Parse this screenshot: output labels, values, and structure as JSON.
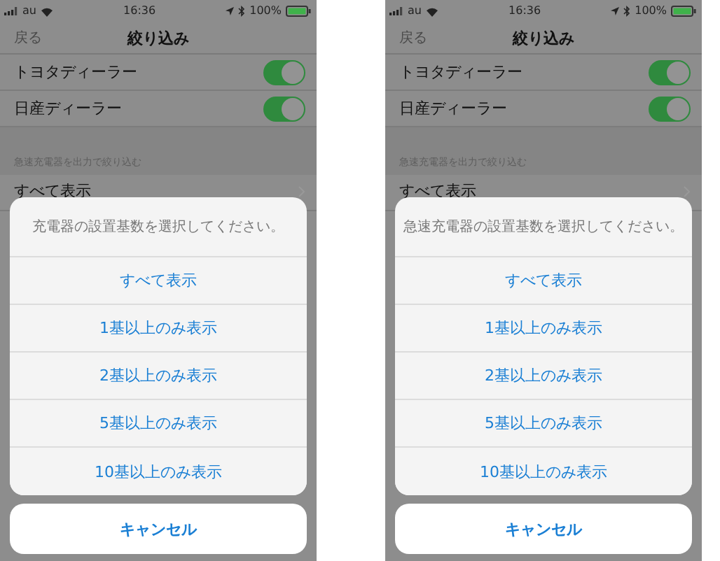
{
  "phones": [
    {
      "status_bar": {
        "carrier": "au",
        "time": "16:36",
        "battery": "100%"
      },
      "nav": {
        "back": "戻る",
        "title": "絞り込み"
      },
      "toggles": [
        {
          "label": "トヨタディーラー",
          "on": true
        },
        {
          "label": "日産ディーラー",
          "on": true
        }
      ],
      "section_header": "急速充電器を出力で絞り込む",
      "row": {
        "label": "すべて表示"
      },
      "action_sheet": {
        "message": "充電器の設置基数を選択してください。",
        "options": [
          "すべて表示",
          "1基以上のみ表示",
          "2基以上のみ表示",
          "5基以上のみ表示",
          "10基以上のみ表示"
        ],
        "cancel": "キャンセル"
      }
    },
    {
      "status_bar": {
        "carrier": "au",
        "time": "16:36",
        "battery": "100%"
      },
      "nav": {
        "back": "戻る",
        "title": "絞り込み"
      },
      "toggles": [
        {
          "label": "トヨタディーラー",
          "on": true
        },
        {
          "label": "日産ディーラー",
          "on": true
        }
      ],
      "section_header": "急速充電器を出力で絞り込む",
      "row": {
        "label": "すべて表示"
      },
      "action_sheet": {
        "message": "急速充電器の設置基数を選択してください。",
        "options": [
          "すべて表示",
          "1基以上のみ表示",
          "2基以上のみ表示",
          "5基以上のみ表示",
          "10基以上のみ表示"
        ],
        "cancel": "キャンセル"
      }
    }
  ]
}
